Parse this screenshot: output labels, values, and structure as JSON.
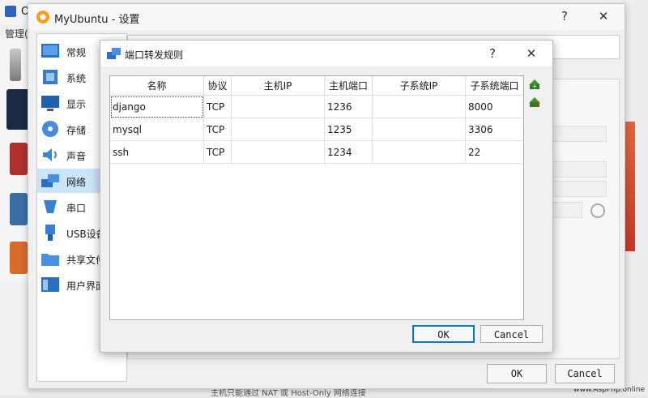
{
  "background_app": {
    "title": "O",
    "menu": "管理(",
    "bottom_text": "主机只能通过 NAT 或 Host-Only 网络连接",
    "watermark": "www.AspPhp.online"
  },
  "settings_window": {
    "title": "MyUbuntu - 设置",
    "help_label": "?",
    "close_label": "✕",
    "sidebar": [
      {
        "label": "常规",
        "icon": "general-icon"
      },
      {
        "label": "系统",
        "icon": "system-icon"
      },
      {
        "label": "显示",
        "icon": "display-icon"
      },
      {
        "label": "存储",
        "icon": "storage-icon"
      },
      {
        "label": "声音",
        "icon": "audio-icon"
      },
      {
        "label": "网络",
        "icon": "network-icon",
        "selected": true
      },
      {
        "label": "串口",
        "icon": "serial-port-icon"
      },
      {
        "label": "USB设备",
        "icon": "usb-icon"
      },
      {
        "label": "共享文件",
        "icon": "shared-folder-icon"
      },
      {
        "label": "用户界面",
        "icon": "user-interface-icon"
      }
    ],
    "ok_label": "OK",
    "cancel_label": "Cancel"
  },
  "dialog": {
    "title": "端口转发规则",
    "help_label": "?",
    "close_label": "✕",
    "columns": [
      "名称",
      "协议",
      "主机IP",
      "主机端口",
      "子系统IP",
      "子系统端口"
    ],
    "rows": [
      {
        "name": "django",
        "protocol": "TCP",
        "host_ip": "",
        "host_port": "1236",
        "guest_ip": "",
        "guest_port": "8000"
      },
      {
        "name": "mysql",
        "protocol": "TCP",
        "host_ip": "",
        "host_port": "1235",
        "guest_ip": "",
        "guest_port": "3306"
      },
      {
        "name": "ssh",
        "protocol": "TCP",
        "host_ip": "",
        "host_port": "1234",
        "guest_ip": "",
        "guest_port": "22"
      }
    ],
    "add_rule_icon": "add-rule-icon",
    "remove_rule_icon": "remove-rule-icon",
    "ok_label": "OK",
    "cancel_label": "Cancel",
    "colors": {
      "accent": "#0078d7",
      "selection": "#cce4f7",
      "add": "#3a9a2a",
      "remove": "#c0392b"
    }
  }
}
